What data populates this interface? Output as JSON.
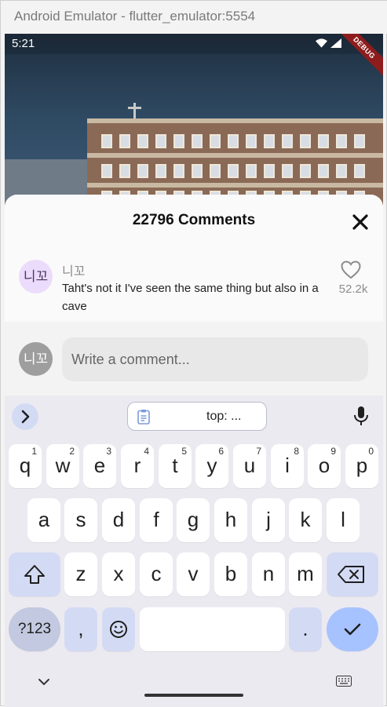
{
  "window": {
    "title": "Android Emulator - flutter_emulator:5554"
  },
  "statusbar": {
    "time": "5:21",
    "debug_label": "DEBUG"
  },
  "sheet": {
    "title": "22796 Comments",
    "comment": {
      "avatar_text": "니꼬",
      "author": "니꼬",
      "text": "Taht's not it I've seen the same thing but also in a cave",
      "likes": "52.2k"
    },
    "composer": {
      "avatar_text": "니꼬",
      "placeholder": "Write a comment..."
    }
  },
  "keyboard": {
    "clipboard_text": "top: ...",
    "row1": [
      {
        "ch": "q",
        "num": "1"
      },
      {
        "ch": "w",
        "num": "2"
      },
      {
        "ch": "e",
        "num": "3"
      },
      {
        "ch": "r",
        "num": "4"
      },
      {
        "ch": "t",
        "num": "5"
      },
      {
        "ch": "y",
        "num": "6"
      },
      {
        "ch": "u",
        "num": "7"
      },
      {
        "ch": "i",
        "num": "8"
      },
      {
        "ch": "o",
        "num": "9"
      },
      {
        "ch": "p",
        "num": "0"
      }
    ],
    "row2": [
      "a",
      "s",
      "d",
      "f",
      "g",
      "h",
      "j",
      "k",
      "l"
    ],
    "row3": [
      "z",
      "x",
      "c",
      "v",
      "b",
      "n",
      "m"
    ],
    "symbols_label": "?123",
    "comma": ",",
    "period": "."
  }
}
